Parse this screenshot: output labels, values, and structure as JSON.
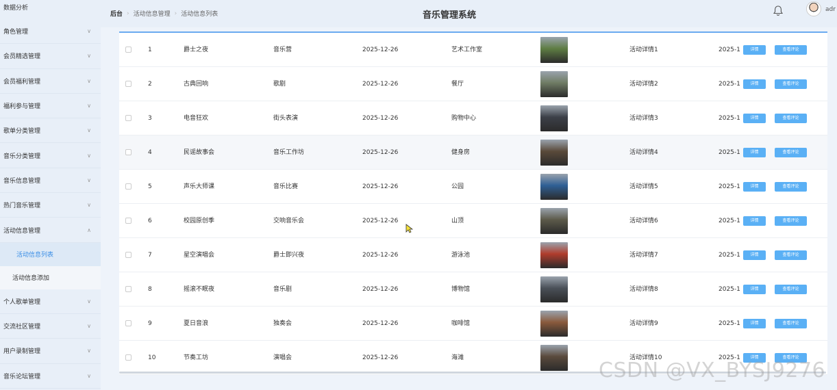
{
  "sidebar": {
    "top": "数据分析",
    "items": [
      {
        "label": "角色管理"
      },
      {
        "label": "会员精选管理"
      },
      {
        "label": "会员福利管理"
      },
      {
        "label": "福利参与管理"
      },
      {
        "label": "歌单分类管理"
      },
      {
        "label": "音乐分类管理"
      },
      {
        "label": "音乐信息管理"
      },
      {
        "label": "热门音乐管理"
      },
      {
        "label": "活动信息管理",
        "expanded": true
      }
    ],
    "subitems": [
      {
        "label": "活动信息列表",
        "active": true
      },
      {
        "label": "活动信息添加"
      }
    ],
    "items_after": [
      {
        "label": "个人歌单管理"
      },
      {
        "label": "交流社区管理"
      },
      {
        "label": "用户录制管理"
      },
      {
        "label": "音乐论坛管理"
      }
    ]
  },
  "header": {
    "crumb_root": "后台",
    "crumb_1": "活动信息管理",
    "crumb_2": "活动信息列表",
    "title": "音乐管理系统",
    "user": "adr"
  },
  "table": {
    "detail_btn": "详情",
    "comment_btn": "查看评论",
    "rows": [
      {
        "no": "1",
        "name": "爵士之夜",
        "type": "音乐营",
        "date": "2025-12-26",
        "place": "艺术工作室",
        "detail": "活动详情1",
        "date2": "2025-1",
        "thumb": "#5e7d43"
      },
      {
        "no": "2",
        "name": "古典回响",
        "type": "歌剧",
        "date": "2025-12-26",
        "place": "餐厅",
        "detail": "活动详情2",
        "date2": "2025-1",
        "thumb": "#6f7c64"
      },
      {
        "no": "3",
        "name": "电音狂欢",
        "type": "街头表演",
        "date": "2025-12-26",
        "place": "购物中心",
        "detail": "活动详情3",
        "date2": "2025-1",
        "thumb": "#3c4048"
      },
      {
        "no": "4",
        "name": "民谣故事会",
        "type": "音乐工作坊",
        "date": "2025-12-26",
        "place": "健身房",
        "detail": "活动详情4",
        "date2": "2025-1",
        "thumb": "#5a4a3a"
      },
      {
        "no": "5",
        "name": "声乐大师课",
        "type": "音乐比赛",
        "date": "2025-12-26",
        "place": "公园",
        "detail": "活动详情5",
        "date2": "2025-1",
        "thumb": "#2f5f95"
      },
      {
        "no": "6",
        "name": "校园原创季",
        "type": "交响音乐会",
        "date": "2025-12-26",
        "place": "山顶",
        "detail": "活动详情6",
        "date2": "2025-1",
        "thumb": "#5c5a4a"
      },
      {
        "no": "7",
        "name": "星空演唱会",
        "type": "爵士即兴夜",
        "date": "2025-12-26",
        "place": "游泳池",
        "detail": "活动详情7",
        "date2": "2025-1",
        "thumb": "#b03c2c"
      },
      {
        "no": "8",
        "name": "摇滚不眠夜",
        "type": "音乐剧",
        "date": "2025-12-26",
        "place": "博物馆",
        "detail": "活动详情8",
        "date2": "2025-1",
        "thumb": "#4a5058"
      },
      {
        "no": "9",
        "name": "夏日音浪",
        "type": "独奏会",
        "date": "2025-12-26",
        "place": "咖啡馆",
        "detail": "活动详情9",
        "date2": "2025-1",
        "thumb": "#8a5a3c"
      },
      {
        "no": "10",
        "name": "节奏工坊",
        "type": "演唱会",
        "date": "2025-12-26",
        "place": "海滩",
        "detail": "活动详情10",
        "date2": "2025-1",
        "thumb": "#5a4a3c"
      }
    ]
  },
  "watermark": "CSDN @VX_BYSJ9276"
}
